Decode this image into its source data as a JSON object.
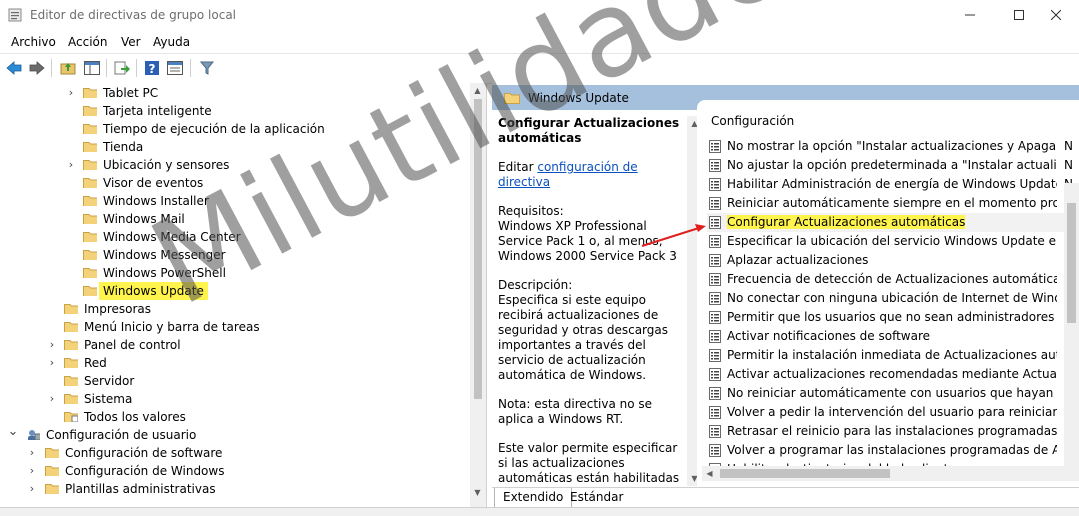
{
  "window": {
    "title": "Editor de directivas de grupo local"
  },
  "menu": [
    "Archivo",
    "Acción",
    "Ver",
    "Ayuda"
  ],
  "toolbar_icons": [
    "back-icon",
    "forward-icon",
    "up-folder-icon",
    "show-hide-tree-icon",
    "export-icon",
    "help-icon",
    "properties-icon",
    "filter-icon"
  ],
  "tree": {
    "items": [
      {
        "label": "Tablet PC",
        "expandable": true
      },
      {
        "label": "Tarjeta inteligente",
        "expandable": false
      },
      {
        "label": "Tiempo de ejecución de la aplicación",
        "expandable": false
      },
      {
        "label": "Tienda",
        "expandable": false
      },
      {
        "label": "Ubicación y sensores",
        "expandable": true
      },
      {
        "label": "Visor de eventos",
        "expandable": false
      },
      {
        "label": "Windows Installer",
        "expandable": false
      },
      {
        "label": "Windows Mail",
        "expandable": false
      },
      {
        "label": "Windows Media Center",
        "expandable": false
      },
      {
        "label": "Windows Messenger",
        "expandable": false
      },
      {
        "label": "Windows PowerShell",
        "expandable": false
      },
      {
        "label": "Windows Update",
        "expandable": false,
        "selected": true
      },
      {
        "label": "Impresoras",
        "expandable": false
      },
      {
        "label": "Menú Inicio y barra de tareas",
        "expandable": false
      },
      {
        "label": "Panel de control",
        "expandable": true
      },
      {
        "label": "Red",
        "expandable": true
      },
      {
        "label": "Servidor",
        "expandable": false
      },
      {
        "label": "Sistema",
        "expandable": true
      },
      {
        "label": "Todos los valores",
        "expandable": false
      },
      {
        "label": "Configuración de usuario",
        "expandable": true
      },
      {
        "label": "Configuración de software",
        "expandable": true
      },
      {
        "label": "Configuración de Windows",
        "expandable": true
      },
      {
        "label": "Plantillas administrativas",
        "expandable": true
      }
    ]
  },
  "details": {
    "header": "Windows Update",
    "title": "Configurar Actualizaciones automáticas",
    "edit_prefix": "Editar",
    "edit_link": "configuración de directiva",
    "requirements_label": "Requisitos:",
    "requirements": "Windows XP Professional Service Pack 1 o, al menos, Windows 2000 Service Pack 3",
    "description_label": "Descripción:",
    "description": "Especifica si este equipo recibirá actualizaciones de seguridad y otras descargas importantes a través del servicio de actualización automática de Windows.",
    "note": "Nota: esta directiva no se aplica a Windows RT.",
    "extra": "Este valor permite especificar si las actualizaciones automáticas están habilitadas en el equipo. Si el servicio está habilitado, debe seleccionar una de las cuatro"
  },
  "list": {
    "column_header": "Configuración",
    "state_letter": "N",
    "items": [
      "No mostrar la opción \"Instalar actualizaciones y Apagar\" en ...",
      "No ajustar la opción predeterminada a \"Instalar actualizacio...",
      "Habilitar Administración de energía de Windows Update par...",
      "Reiniciar automáticamente siempre en el momento progra...",
      "Configurar Actualizaciones automáticas",
      "Especificar la ubicación del servicio Windows Update en la i...",
      "Aplazar actualizaciones",
      "Frecuencia de detección de Actualizaciones automáticas",
      "No conectar con ninguna ubicación de Internet de Window...",
      "Permitir que los usuarios que no sean administradores recib...",
      "Activar notificaciones de software",
      "Permitir la instalación inmediata de Actualizaciones automá...",
      "Activar actualizaciones recomendadas mediante Actualizaci...",
      "No reiniciar automáticamente con usuarios que hayan inicia...",
      "Volver a pedir la intervención del usuario para reiniciar con i...",
      "Retrasar el reinicio para las instalaciones programadas",
      "Volver a programar las instalaciones programadas de Actuali...",
      "Habilitar destinatarios del lado cliente"
    ],
    "selected_index": 4
  },
  "tabs": [
    "Extendido",
    "Estándar"
  ],
  "watermark": "Milutilidades.com",
  "colors": {
    "highlight": "#fff44d",
    "header_bar": "#a5c0dd",
    "link": "#0b50c0"
  }
}
